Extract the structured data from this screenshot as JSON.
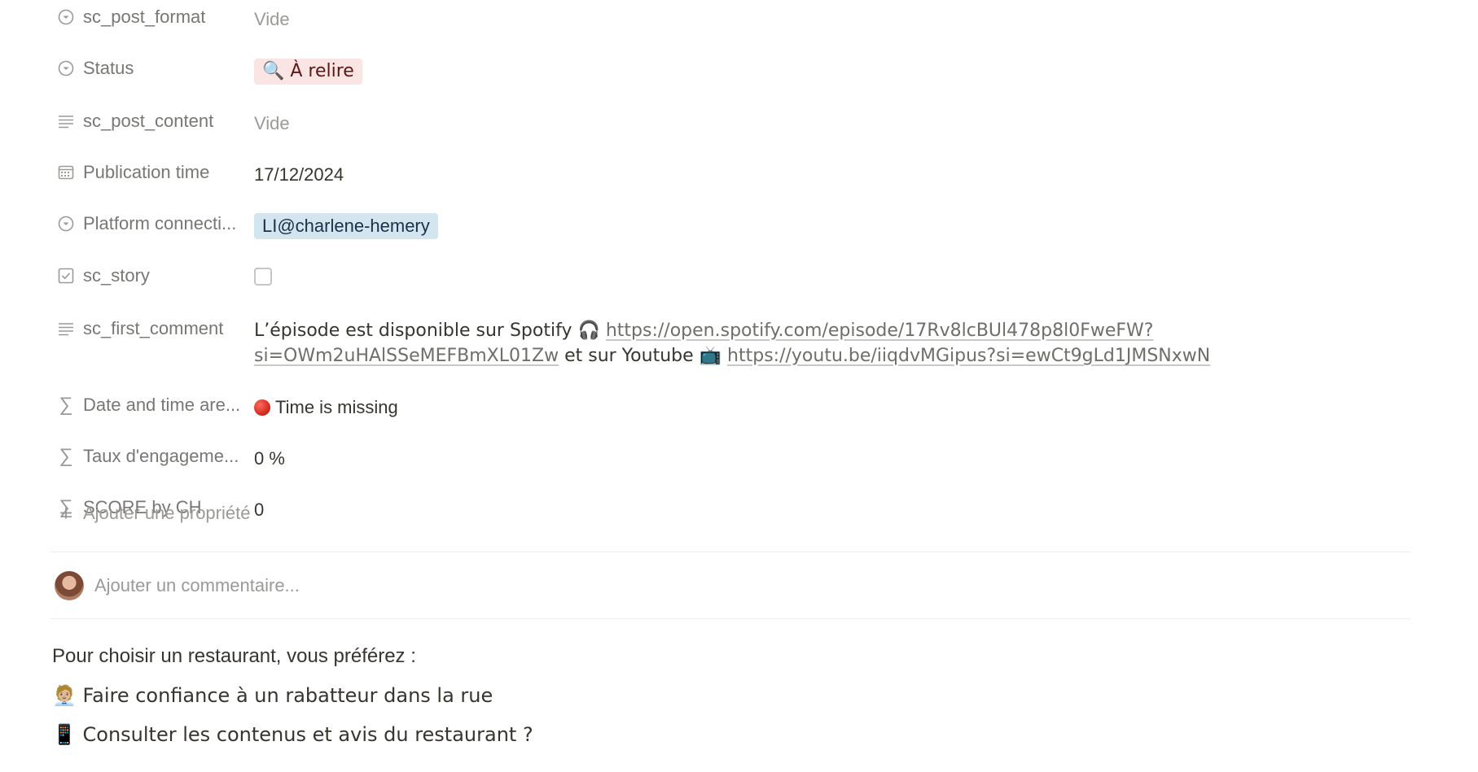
{
  "properties": [
    {
      "icon": "select-icon",
      "label": "sc_post_format",
      "value": "Vide",
      "empty": true
    },
    {
      "icon": "select-icon",
      "label": "Status",
      "tag": "🔍 À relire",
      "tag_color": "#fbe4e4"
    },
    {
      "icon": "text-icon",
      "label": "sc_post_content",
      "value": "Vide",
      "empty": true
    },
    {
      "icon": "calendar-icon",
      "label": "Publication time",
      "value": "17/12/2024"
    },
    {
      "icon": "select-icon",
      "label": "Platform connecti...",
      "tag": "LI@charlene-hemery",
      "tag_color": "#d3e5ef"
    },
    {
      "icon": "checkbox-icon",
      "label": "sc_story",
      "checked": false
    },
    {
      "icon": "text-icon",
      "label": "sc_first_comment",
      "text1": "L’épisode est disponible sur Spotify 🎧 ",
      "link1": "https://open.spotify.com/episode/17Rv8lcBUl478p8l0FweFW?si=OWm2uHAlSSeMEFBmXL01Zw",
      "text2": " et sur Youtube 📺 ",
      "link2": "https://youtu.be/iiqdvMGipus?si=ewCt9gLd1JMSNxwN"
    },
    {
      "icon": "formula-icon",
      "label": "Date and time are...",
      "value": "Time is missing"
    },
    {
      "icon": "formula-icon",
      "label": "Taux d'engageme...",
      "value": "0 %"
    },
    {
      "icon": "formula-icon",
      "label": "SCORE by CH",
      "value": "0"
    }
  ],
  "add_property": "Ajouter une propriété",
  "comment_placeholder": "Ajouter un commentaire...",
  "body": {
    "line1": "Pour choisir un restaurant, vous préférez :",
    "line2": "🧑🏼‍💼 Faire confiance à un rabatteur dans la rue",
    "line3": "📱 Consulter les contenus et avis du restaurant ?"
  },
  "colors": {
    "text": "#37352f",
    "muted": "#9b9a97",
    "status_tag_bg": "#fbe4e4",
    "platform_tag_bg": "#d3e5ef"
  }
}
